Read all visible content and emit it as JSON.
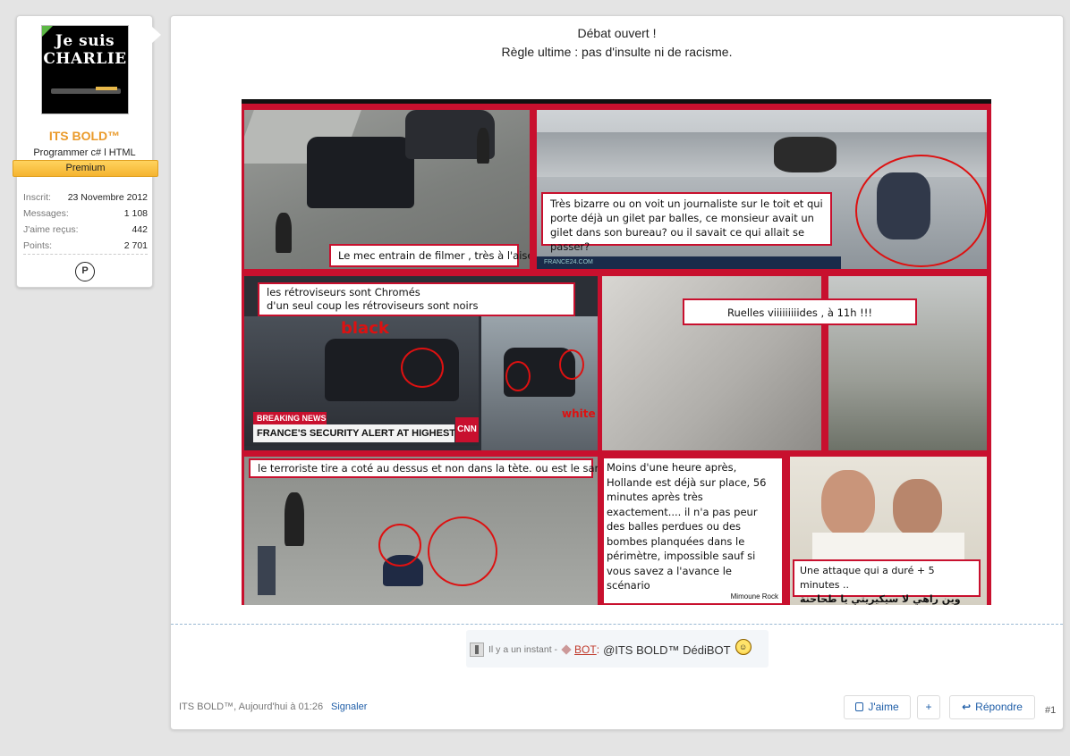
{
  "user": {
    "avatar_text": "Je suis\nCHARLIE",
    "username": "ITS BOLD™",
    "title": "Programmer c# l HTML",
    "badge": "Premium",
    "stats": [
      {
        "label": "Inscrit:",
        "value": "23 Novembre 2012"
      },
      {
        "label": "Messages:",
        "value": "1 108"
      },
      {
        "label": "J'aime reçus:",
        "value": "442"
      },
      {
        "label": "Points:",
        "value": "2 701"
      }
    ],
    "platform_icon": "playstation-icon"
  },
  "post": {
    "line1": "Débat ouvert !",
    "line2": "Règle ultime : pas d'insulte ni de racisme."
  },
  "collage": {
    "cap1": "Le mec entrain de filmer , très à l'aise",
    "cap2": "Très bizarre ou on voit un journaliste  sur le toit et qui porte déjà un gilet par balles, ce monsieur avait un gilet dans son  bureau? ou il  savait ce qui allait se passer?",
    "cap3": "les rétroviseurs sont Chromés\nd'un seul coup les rétroviseurs sont noirs",
    "black_label": "black",
    "white_label": "white",
    "breaking": "BREAKING NEWS",
    "alert": "FRANCE'S SECURITY ALERT AT HIGHEST LEVEL",
    "cnn": "CNN",
    "cap4": "Ruelles viiiiiiiiides , à 11h !!!",
    "cap5": "le terroriste tire a coté au dessus et non dans la tète. ou est le sang ?",
    "cap6": "Moins d'une heure après, Hollande est déjà sur place, 56 minutes après très exactement.... il n'a pas peur des balles perdues ou des bombes planquées dans le périmètre, impossible sauf si vous savez a l'avance le scénario",
    "signature": "Mimoune Rock",
    "cap7a": "Une attaque qui a  duré + 5 minutes ..",
    "cap7b": "وين راهي لا سيكيريتي يا طحاحنة ؟؟",
    "france24": "FRANCE24.COM"
  },
  "bot": {
    "time": "Il y a un instant -",
    "label": "BOT",
    "colon": ":",
    "message": "@ITS BOLD™ DédiBOT"
  },
  "footer": {
    "meta": "ITS BOLD™, Aujourd'hui à 01:26",
    "report": "Signaler",
    "like": "J'aime",
    "plus": "+",
    "reply": "Répondre",
    "post_number": "#1"
  }
}
